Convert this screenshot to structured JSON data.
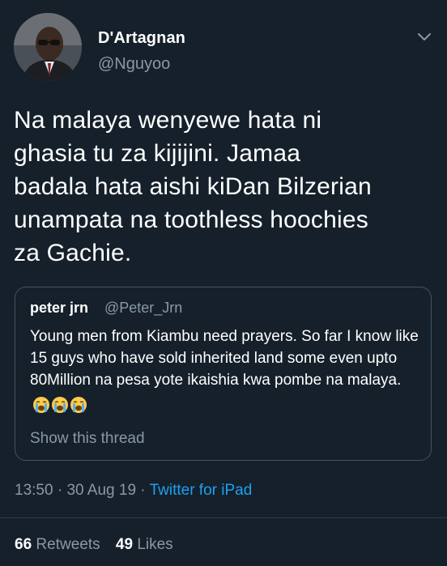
{
  "author": {
    "display_name": "D'Artagnan",
    "handle": "@Nguyoo"
  },
  "tweet": {
    "text": "Na malaya wenyewe hata ni\nghasia tu za kijijini. Jamaa\nbadala hata aishi kiDan Bilzerian\nunampata na toothless hoochies\nza Gachie."
  },
  "quoted_tweet": {
    "name": "peter jrn",
    "handle": "@Peter_Jrn",
    "text": "Young men from Kiambu need prayers. So far I know like 15 guys who have sold inherited land some even upto 80Million na pesa yote ikaishia kwa pombe na malaya.",
    "emoji_names": [
      "loudly-crying-face",
      "loudly-crying-face",
      "loudly-crying-face"
    ],
    "show_thread_label": "Show this thread"
  },
  "meta": {
    "time": "13:50",
    "separator1": " · ",
    "date": "30 Aug 19",
    "separator2": " · ",
    "source": "Twitter for iPad"
  },
  "stats": {
    "retweets_count": "66",
    "retweets_label": "Retweets",
    "likes_count": "49",
    "likes_label": "Likes"
  },
  "colors": {
    "background": "#15202b",
    "secondary_text": "#8899a6",
    "accent": "#1da1f2",
    "border": "#3d5466"
  }
}
